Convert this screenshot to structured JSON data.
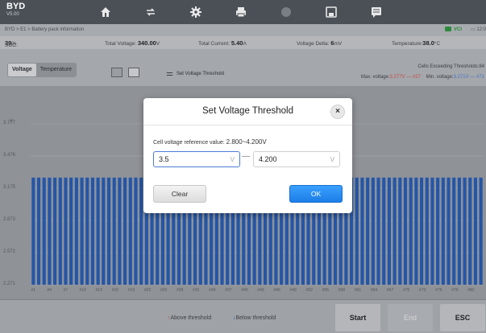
{
  "app": {
    "brand": "BYD",
    "version": "V5.00"
  },
  "topnav": [
    {
      "name": "home-icon",
      "glyph": "⌂"
    },
    {
      "name": "vehicle-swap-icon",
      "glyph": "⇄"
    },
    {
      "name": "settings-gear-icon",
      "glyph": "✱"
    },
    {
      "name": "print-icon",
      "glyph": "▤"
    },
    {
      "name": "help-icon",
      "glyph": "●"
    },
    {
      "name": "save-icon",
      "glyph": "▣"
    },
    {
      "name": "message-icon",
      "glyph": "▦"
    }
  ],
  "breadcrumb": "BYD > E1 > Battery pack information",
  "status": {
    "vci": "VCI",
    "battery": "12:0"
  },
  "info": {
    "soc_label": "SOC:",
    "soc_value": "39",
    "soc_unit": "%",
    "total_voltage_label": "Total Voltage:",
    "total_voltage_value": "340.00",
    "total_voltage_unit": "V",
    "total_current_label": "Total Current:",
    "total_current_value": "5.40",
    "total_current_unit": "A",
    "voltage_delta_label": "Voltage Delta:",
    "voltage_delta_value": "6",
    "voltage_delta_unit": "mV",
    "temperature_label": "Temperature:",
    "temperature_value": "38.0",
    "temperature_unit": "°C"
  },
  "toolbar": {
    "tabs": [
      "Voltage",
      "Temperature"
    ],
    "set_threshold_label": "Set Voltage Threshold",
    "cells_exceeding_label": "Cells Exceeding Thresholds:84",
    "max_voltage_label": "Max. voltage:",
    "max_voltage_value": "3.277V — #27",
    "min_voltage_label": "Min. voltage:",
    "min_voltage_value": "3.271V — #71"
  },
  "chart_data": {
    "type": "bar",
    "ylabel": "V",
    "y_ticks": [
      "3.777",
      "3.476",
      "3.175",
      "2.873",
      "2.572",
      "2.271"
    ],
    "ylim": [
      2.271,
      3.777
    ],
    "x_tick_labels": [
      "#1",
      "#4",
      "#7",
      "#10",
      "#13",
      "#16",
      "#19",
      "#22",
      "#25",
      "#28",
      "#31",
      "#34",
      "#37",
      "#40",
      "#43",
      "#46",
      "#49",
      "#52",
      "#55",
      "#58",
      "#61",
      "#64",
      "#67",
      "#70",
      "#73",
      "#76",
      "#79",
      "#82"
    ],
    "cell_count": 84,
    "value": 3.274,
    "bar_color": "#2456a8"
  },
  "bottom": {
    "above_label": "Above threshold",
    "below_label": "Below threshold",
    "start": "Start",
    "end": "End",
    "esc": "ESC"
  },
  "dialog": {
    "title": "Set Voltage Threshold",
    "ref_label": "Cell voltage reference value:",
    "ref_value": "2.800~4.200V",
    "min_value": "3.5",
    "max_value": "4.200",
    "unit": "V",
    "clear": "Clear",
    "ok": "OK"
  }
}
